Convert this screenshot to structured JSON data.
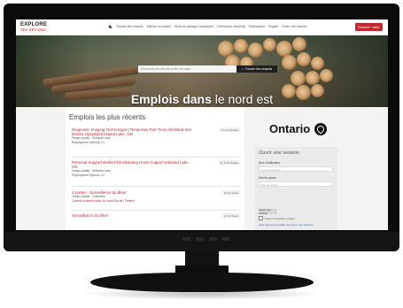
{
  "site": {
    "logo_main": "EXPLORE",
    "logo_sub": "TES OPTIONS"
  },
  "nav": {
    "items": [
      "Trouver des emplois",
      "Afficher un emploi",
      "Outils de partage d'employés",
      "Chercheurs d'emplois",
      "Employeurs",
      "English",
      "Ouvrir une session"
    ],
    "cta": "S'inscrire 'maint."
  },
  "hero": {
    "search_placeholder": "Recherche par mot-clé ou titre de poste...",
    "search_button": "Trouver des emplois",
    "title_bold": "Emplois dans",
    "title_light": "le nord est"
  },
  "jobs": {
    "section_title": "Emplois les plus récents",
    "items": [
      {
        "title": "Diagnostic Imaging Technologist (Temporary Part Time) (Kirkland and District Hospital) Kirkland Lake, ON",
        "type": "Temps partiel - Kirkland Lake",
        "org": "Employment Options, KL",
        "date": "Il y a 4 minutes"
      },
      {
        "title": "Personal Support Worker/Timiskaming Home support Kirkland Lake, ON",
        "type": "Temps partiel - Kirkland Lake",
        "org": "Employment Options, KL",
        "date": "Il y a 45 minutes"
      },
      {
        "title": "2 postes - Surveillance du dîner",
        "type": "Temps partiel - Cochrane",
        "org": "Conseil scolaire public du Nord-Est de l'Ontario",
        "date": "Il y a 1 heure"
      },
      {
        "title": "Surveillance du dîner",
        "date": "Il y a 1 heure"
      }
    ]
  },
  "ontario": {
    "wordmark": "Ontario"
  },
  "login": {
    "title": "Ouvrir une session",
    "username_label": "Nom d'utilisateur",
    "username_placeholder": "Nom d'utilisateur",
    "password_label": "Mot de passe",
    "password_placeholder": "Mot de passe",
    "button": "Ouvrir une session",
    "remember": "Garder ma session ouverte",
    "help": "Vous avez besoin d'aide pour ouvrir une session?"
  },
  "colors": {
    "accent": "#c1272d",
    "link": "#3c5aa6"
  }
}
